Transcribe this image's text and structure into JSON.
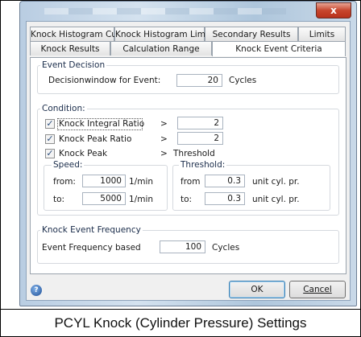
{
  "window": {
    "close_glyph": "x"
  },
  "tabs_row1": [
    {
      "label": "Knock Histogram Curves"
    },
    {
      "label": "Knock Histogram Limits"
    },
    {
      "label": "Secondary Results"
    },
    {
      "label": "Limits"
    }
  ],
  "tabs_row2": [
    {
      "label": "Knock Results"
    },
    {
      "label": "Calculation Range"
    },
    {
      "label": "Knock Event Criteria",
      "active": true
    }
  ],
  "event_decision": {
    "group_label": "Event Decision",
    "label": "Decisionwindow for Event:",
    "value": "20",
    "unit": "Cycles"
  },
  "condition": {
    "group_label": "Condition:",
    "items": [
      {
        "label": "Knock Integral Ratio",
        "checked": true,
        "op": ">",
        "value": "2"
      },
      {
        "label": "Knock Peak Ratio",
        "checked": true,
        "op": ">",
        "value": "2"
      },
      {
        "label": "Knock Peak",
        "checked": true,
        "op": ">",
        "value_text": "Threshold"
      }
    ],
    "speed": {
      "label": "Speed:",
      "from_label": "from:",
      "from_value": "1000",
      "from_unit": "1/min",
      "to_label": "to:",
      "to_value": "5000",
      "to_unit": "1/min"
    },
    "threshold": {
      "label": "Threshold:",
      "from_label": "from",
      "from_value": "0.3",
      "from_unit": "unit cyl. pr.",
      "to_label": "to:",
      "to_value": "0.3",
      "to_unit": "unit cyl. pr."
    }
  },
  "frequency": {
    "group_label": "Knock Event Frequency",
    "label": "Event Frequency based",
    "value": "100",
    "unit": "Cycles"
  },
  "buttons": {
    "ok": "OK",
    "cancel": "Cancel",
    "help_glyph": "?"
  },
  "caption": "PCYL Knock (Cylinder Pressure) Settings"
}
